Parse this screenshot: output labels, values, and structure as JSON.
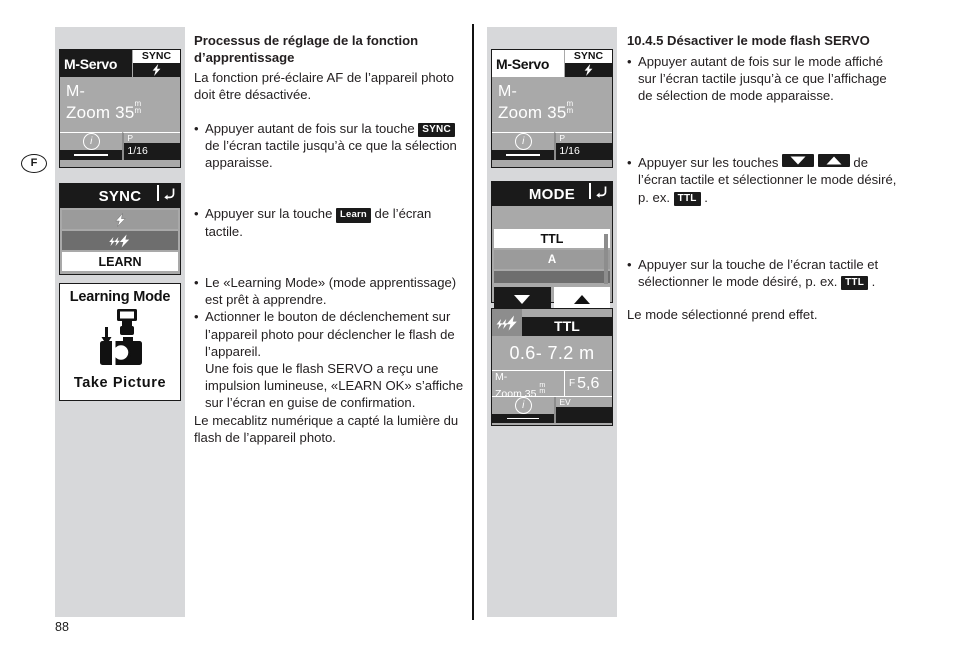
{
  "page": {
    "folio": "88",
    "language_marker": "F"
  },
  "left_column": {
    "status_screen": {
      "mode_label": "M-Servo",
      "sync_label": "SYNC",
      "sync_icon": "flash-bolt-icon",
      "main_line1": "M-",
      "main_line2": "Zoom 35",
      "main_unit": "mm",
      "info_icon": "info-circle-icon",
      "right_label": "P",
      "right_value": "1/16"
    },
    "sync_menu": {
      "title": "SYNC",
      "back_icon": "return-arrow-icon",
      "rows": [
        {
          "type": "icon",
          "icon": "single-bolt-icon"
        },
        {
          "type": "icon",
          "icon": "triple-bolt-icon"
        },
        {
          "type": "selected",
          "label": "LEARN"
        }
      ]
    },
    "learning_picture": {
      "caption_top": "Learning Mode",
      "caption_bottom": "Take Picture",
      "art_icon": "camera-with-flash-icon"
    }
  },
  "left_text": {
    "heading": "Processus de réglage de la fonction d’apprentissage",
    "intro": "La fonction pré-éclaire AF de l’appareil photo doit être désactivée.",
    "bullet1_pre": "Appuyer autant de fois sur la touche",
    "bullet1_badge": "SYNC",
    "bullet1_post": "de l’écran tactile jusqu’à ce que la sélection apparaisse.",
    "bullet2_pre": "Appuyer sur la touche",
    "bullet2_badge": "Learn",
    "bullet2_post": "de l’écran tactile.",
    "bullet3": "Le «Learning Mode» (mode apprentissage) est prêt à apprendre.",
    "bullet4": "Actionner le bouton de déclenchement sur l’appareil photo pour déclencher le flash de l’appareil.",
    "bullet4_cont": "Une fois que le flash SERVO a reçu une impulsion lumineuse, «LEARN OK» s’affiche sur l’écran en guise de confirmation.",
    "closing": "Le mecablitz numérique a capté la lumière du flash de l’appareil photo."
  },
  "right_column": {
    "status_screen": {
      "mode_label": "M-Servo",
      "sync_label": "SYNC",
      "sync_icon": "flash-bolt-icon",
      "main_line1": "M-",
      "main_line2": "Zoom 35",
      "main_unit": "mm",
      "info_icon": "info-circle-icon",
      "right_label": "P",
      "right_value": "1/16"
    },
    "mode_menu": {
      "title": "MODE",
      "back_icon": "return-arrow-icon",
      "rows": [
        {
          "type": "blank"
        },
        {
          "type": "selected",
          "label": "TTL"
        },
        {
          "type": "option",
          "label": "A"
        },
        {
          "type": "blank"
        }
      ],
      "button_down_icon": "arrow-down-icon",
      "button_up_icon": "arrow-up-icon"
    },
    "ttl_screen": {
      "flash_icon": "triple-bolt-icon",
      "mode_label": "TTL",
      "distance": "0.6- 7.2 m",
      "zoom_line1": "M-",
      "zoom_line2": "Zoom 35",
      "zoom_unit": "mm",
      "aperture_prefix": "F",
      "aperture_value": "5,6",
      "info_icon": "info-circle-icon",
      "ev_label": "EV"
    }
  },
  "right_text": {
    "heading": "10.4.5 Désactiver le mode flash SERVO",
    "bullet1": "Appuyer autant de fois sur le mode affiché sur l’écran tactile jusqu’à ce que l’affichage de sélection de mode apparaisse.",
    "bullet2_pre": "Appuyer sur les touches",
    "bullet2_badge_down": "arrow-down-icon",
    "bullet2_badge_up": "arrow-up-icon",
    "bullet2_mid": "de l’écran tactile et sélectionner le mode désiré, p. ex.",
    "bullet2_badge": "TTL",
    "bullet2_post": ".",
    "bullet3_pre": "Appuyer sur la touche de l’écran tactile et sélectionner le mode désiré, p. ex.",
    "bullet3_badge": "TTL",
    "bullet3_post": ".",
    "closing": "Le mode sélectionné prend effet."
  },
  "colors": {
    "panel_gray": "#d7d8da",
    "lcd_gray": "#a9a9a9",
    "ink": "#1a1a1a"
  }
}
